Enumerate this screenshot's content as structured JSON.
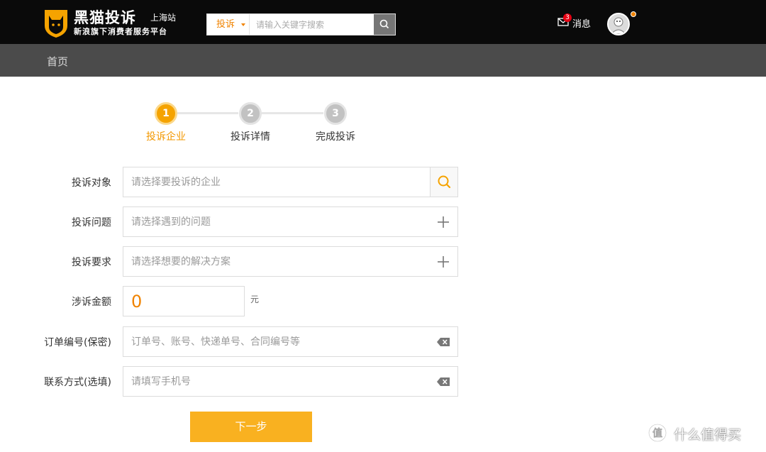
{
  "header": {
    "brand_title": "黑猫投诉",
    "brand_subtitle": "新浪旗下消费者服务平台",
    "station": "上海站",
    "search": {
      "type_label": "投诉",
      "placeholder": "请输入关键字搜索"
    },
    "messages": {
      "label": "消息",
      "badge": "3"
    }
  },
  "nav": {
    "home": "首页"
  },
  "stepper": {
    "steps": [
      {
        "number": "1",
        "label": "投诉企业",
        "state": "active"
      },
      {
        "number": "2",
        "label": "投诉详情",
        "state": "pending"
      },
      {
        "number": "3",
        "label": "完成投诉",
        "state": "pending"
      }
    ]
  },
  "form": {
    "target": {
      "label": "投诉对象",
      "placeholder": "请选择要投诉的企业"
    },
    "issue": {
      "label": "投诉问题",
      "placeholder": "请选择遇到的问题"
    },
    "demand": {
      "label": "投诉要求",
      "placeholder": "请选择想要的解决方案"
    },
    "amount": {
      "label": "涉诉金额",
      "value": "0",
      "unit": "元"
    },
    "order": {
      "label": "订单编号(保密)",
      "placeholder": "订单号、账号、快递单号、合同编号等"
    },
    "contact": {
      "label": "联系方式(选填)",
      "placeholder": "请填写手机号"
    },
    "next_label": "下一步"
  },
  "watermark": {
    "text": "什么值得买"
  },
  "colors": {
    "accent": "#f9b120",
    "accent_text": "#f39800",
    "topbar": "#0a0a0a",
    "navbar": "#4b4b4b",
    "badge": "#e60012"
  }
}
